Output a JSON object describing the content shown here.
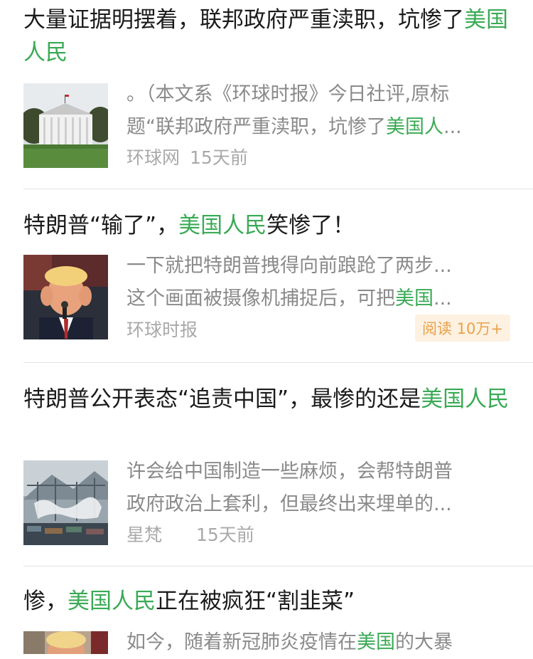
{
  "articles": [
    {
      "title_segments": [
        {
          "text": "大量证据明摆着，联邦政府严重渎职，坑惨了",
          "hl": false
        },
        {
          "text": "美国人民",
          "hl": true
        }
      ],
      "thumb_icon": "white-house-photo",
      "summary_segments": [
        [
          {
            "text": "。（本文系《环球时报》今日社评,原标",
            "hl": false
          }
        ],
        [
          {
            "text": "题“联邦政府严重渎职，坑惨了",
            "hl": false
          },
          {
            "text": "美国人",
            "hl": true
          },
          {
            "text": "...",
            "hl": false
          }
        ]
      ],
      "source": "环球网",
      "time": "15天前"
    },
    {
      "title_segments": [
        {
          "text": "特朗普“输了”，",
          "hl": false
        },
        {
          "text": "美国人民",
          "hl": true
        },
        {
          "text": "笑惨了！",
          "hl": false
        }
      ],
      "thumb_icon": "trump-photo",
      "summary_segments": [
        [
          {
            "text": "一下就把特朗普拽得向前踉跄了两步...",
            "hl": false
          }
        ],
        [
          {
            "text": "这个画面被摄像机捕捉后，可把",
            "hl": false
          },
          {
            "text": "美国",
            "hl": true
          },
          {
            "text": "...",
            "hl": false
          }
        ]
      ],
      "source": "环球时报",
      "read_badge": "阅读 10万+"
    },
    {
      "title_segments": [
        {
          "text": "特朗普公开表态“追责中国”，最惨的还是",
          "hl": false
        },
        {
          "text": "美国人民",
          "hl": true
        }
      ],
      "thumb_icon": "port-map-photo",
      "summary_segments": [
        [
          {
            "text": "许会给中国制造一些麻烦，会帮特朗普",
            "hl": false
          }
        ],
        [
          {
            "text": "政府政治上套利，但最终出来埋单的...",
            "hl": false
          }
        ]
      ],
      "source": "星梵",
      "time": "15天前"
    },
    {
      "title_segments": [
        {
          "text": "惨，",
          "hl": false
        },
        {
          "text": "美国人民",
          "hl": true
        },
        {
          "text": "正在被疯狂“割韭菜”",
          "hl": false
        }
      ],
      "thumb_icon": "trump-photo-2",
      "summary_segments": [
        [
          {
            "text": "如今，随着新冠肺炎疫情在",
            "hl": false
          },
          {
            "text": "美国",
            "hl": true
          },
          {
            "text": "的大暴",
            "hl": false
          }
        ]
      ]
    }
  ],
  "colors": {
    "highlight": "#3aaa55",
    "badge_text": "#e8a24a",
    "badge_bg": "#fdf1e2"
  }
}
